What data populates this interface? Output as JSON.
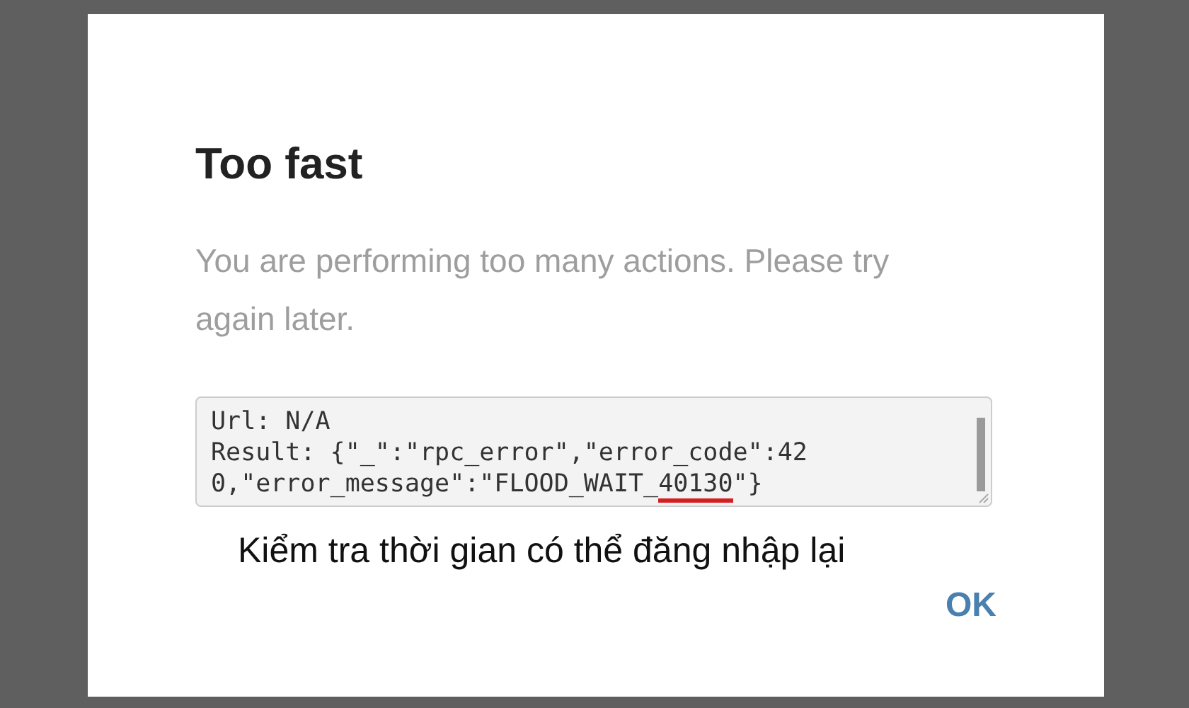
{
  "dialog": {
    "title": "Too fast",
    "message": "You are performing too many actions. Please try again later.",
    "log": {
      "lines": [
        {
          "segments": [
            {
              "text": "Url: N/A",
              "underlined": false
            }
          ]
        },
        {
          "segments": [
            {
              "text": "Result: {\"_\":\"rpc_error\",\"error_code\":42",
              "underlined": false
            }
          ]
        },
        {
          "segments": [
            {
              "text": "0,\"error_message\":\"FLOOD_WAIT_",
              "underlined": false
            },
            {
              "text": "40130",
              "underlined": true
            },
            {
              "text": "\"}",
              "underlined": false
            }
          ]
        }
      ]
    },
    "caption": "Kiểm tra thời gian có thể đăng nhập lại",
    "buttons": [
      "OK"
    ]
  }
}
